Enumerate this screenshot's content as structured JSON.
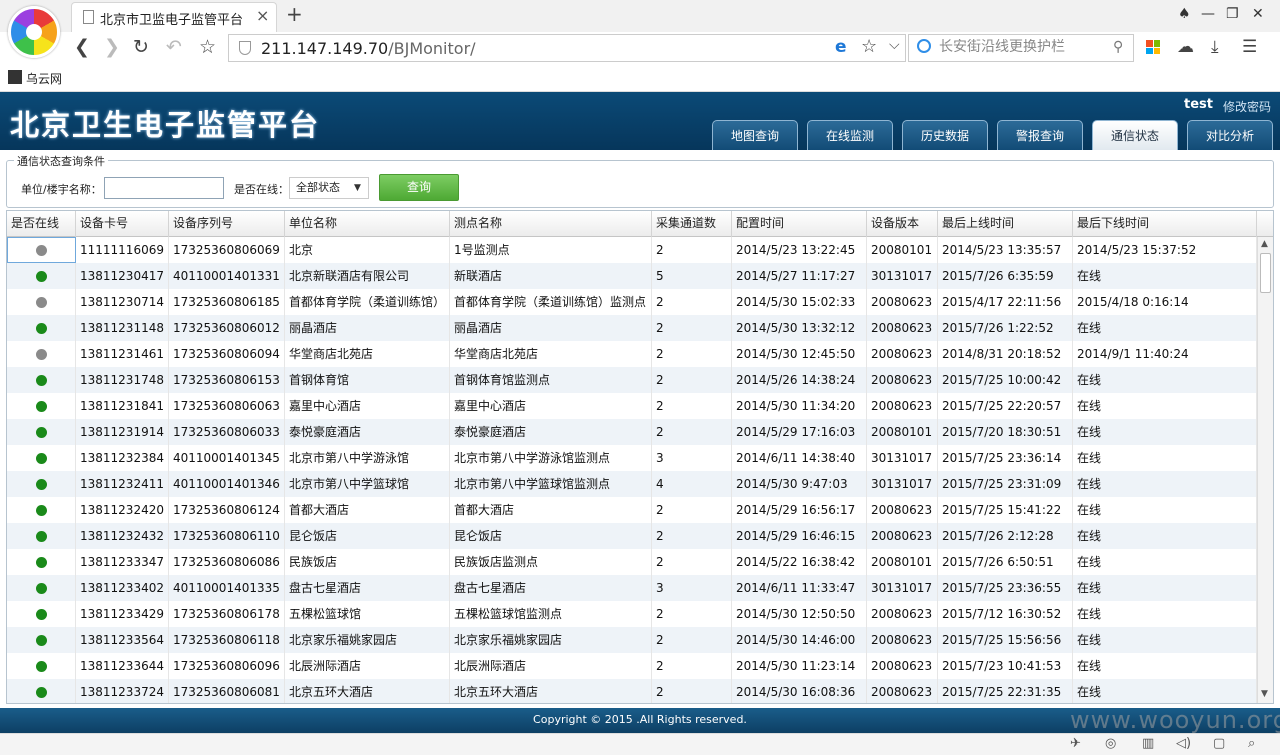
{
  "browser": {
    "tab_title": "北京市卫监电子监管平台",
    "address_host": "211.147.149.70",
    "address_path": "/BJMonitor/",
    "search_placeholder": "长安街沿线更换护栏",
    "bookmark_label": "乌云网"
  },
  "header": {
    "site_title": "北京卫生电子监管平台",
    "user_name": "test",
    "change_password": "修改密码",
    "tabs": [
      {
        "label": "地图查询",
        "active": false
      },
      {
        "label": "在线监测",
        "active": false
      },
      {
        "label": "历史数据",
        "active": false
      },
      {
        "label": "警报查询",
        "active": false
      },
      {
        "label": "通信状态",
        "active": true
      },
      {
        "label": "对比分析",
        "active": false
      }
    ]
  },
  "filter": {
    "legend": "通信状态查询条件",
    "unit_label": "单位/楼宇名称：",
    "unit_value": "",
    "online_label": "是否在线：",
    "status_selected": "全部状态",
    "query_button": "查询"
  },
  "table": {
    "columns": [
      "是否在线",
      "设备卡号",
      "设备序列号",
      "单位名称",
      "测点名称",
      "采集通道数",
      "配置时间",
      "设备版本",
      "最后上线时间",
      "最后下线时间"
    ],
    "status_colors": {
      "online": "#1a8a1a",
      "offline": "#8a8a8a"
    },
    "rows": [
      {
        "online": false,
        "card": "11111116069",
        "serial": "17325360806069",
        "unit": "北京",
        "point": "1号监测点",
        "channels": "2",
        "config_time": "2014/5/23 13:22:45",
        "version": "20080101",
        "last_online": "2014/5/23 13:35:57",
        "last_offline": "2014/5/23 15:37:52"
      },
      {
        "online": true,
        "card": "13811230417",
        "serial": "40110001401331",
        "unit": "北京新联酒店有限公司",
        "point": "新联酒店",
        "channels": "5",
        "config_time": "2014/5/27 11:17:27",
        "version": "30131017",
        "last_online": "2015/7/26 6:35:59",
        "last_offline": "在线"
      },
      {
        "online": false,
        "card": "13811230714",
        "serial": "17325360806185",
        "unit": "首都体育学院（柔道训练馆）",
        "point": "首都体育学院（柔道训练馆）监测点",
        "channels": "2",
        "config_time": "2014/5/30 15:02:33",
        "version": "20080623",
        "last_online": "2015/4/17 22:11:56",
        "last_offline": "2015/4/18 0:16:14"
      },
      {
        "online": true,
        "card": "13811231148",
        "serial": "17325360806012",
        "unit": "丽晶酒店",
        "point": "丽晶酒店",
        "channels": "2",
        "config_time": "2014/5/30 13:32:12",
        "version": "20080623",
        "last_online": "2015/7/26 1:22:52",
        "last_offline": "在线"
      },
      {
        "online": false,
        "card": "13811231461",
        "serial": "17325360806094",
        "unit": "华堂商店北苑店",
        "point": "华堂商店北苑店",
        "channels": "2",
        "config_time": "2014/5/30 12:45:50",
        "version": "20080623",
        "last_online": "2014/8/31 20:18:52",
        "last_offline": "2014/9/1 11:40:24"
      },
      {
        "online": true,
        "card": "13811231748",
        "serial": "17325360806153",
        "unit": "首钢体育馆",
        "point": "首钢体育馆监测点",
        "channels": "2",
        "config_time": "2014/5/26 14:38:24",
        "version": "20080623",
        "last_online": "2015/7/25 10:00:42",
        "last_offline": "在线"
      },
      {
        "online": true,
        "card": "13811231841",
        "serial": "17325360806063",
        "unit": "嘉里中心酒店",
        "point": "嘉里中心酒店",
        "channels": "2",
        "config_time": "2014/5/30 11:34:20",
        "version": "20080623",
        "last_online": "2015/7/25 22:20:57",
        "last_offline": "在线"
      },
      {
        "online": true,
        "card": "13811231914",
        "serial": "17325360806033",
        "unit": "泰悦豪庭酒店",
        "point": "泰悦豪庭酒店",
        "channels": "2",
        "config_time": "2014/5/29 17:16:03",
        "version": "20080101",
        "last_online": "2015/7/20 18:30:51",
        "last_offline": "在线"
      },
      {
        "online": true,
        "card": "13811232384",
        "serial": "40110001401345",
        "unit": "北京市第八中学游泳馆",
        "point": "北京市第八中学游泳馆监测点",
        "channels": "3",
        "config_time": "2014/6/11 14:38:40",
        "version": "30131017",
        "last_online": "2015/7/25 23:36:14",
        "last_offline": "在线"
      },
      {
        "online": true,
        "card": "13811232411",
        "serial": "40110001401346",
        "unit": "北京市第八中学篮球馆",
        "point": "北京市第八中学篮球馆监测点",
        "channels": "4",
        "config_time": "2014/5/30 9:47:03",
        "version": "30131017",
        "last_online": "2015/7/25 23:31:09",
        "last_offline": "在线"
      },
      {
        "online": true,
        "card": "13811232420",
        "serial": "17325360806124",
        "unit": "首都大酒店",
        "point": "首都大酒店",
        "channels": "2",
        "config_time": "2014/5/29 16:56:17",
        "version": "20080623",
        "last_online": "2015/7/25 15:41:22",
        "last_offline": "在线"
      },
      {
        "online": true,
        "card": "13811232432",
        "serial": "17325360806110",
        "unit": "昆仑饭店",
        "point": "昆仑饭店",
        "channels": "2",
        "config_time": "2014/5/29 16:46:15",
        "version": "20080623",
        "last_online": "2015/7/26 2:12:28",
        "last_offline": "在线"
      },
      {
        "online": true,
        "card": "13811233347",
        "serial": "17325360806086",
        "unit": "民族饭店",
        "point": "民族饭店监测点",
        "channels": "2",
        "config_time": "2014/5/22 16:38:42",
        "version": "20080101",
        "last_online": "2015/7/26 6:50:51",
        "last_offline": "在线"
      },
      {
        "online": true,
        "card": "13811233402",
        "serial": "40110001401335",
        "unit": "盘古七星酒店",
        "point": "盘古七星酒店",
        "channels": "3",
        "config_time": "2014/6/11 11:33:47",
        "version": "30131017",
        "last_online": "2015/7/25 23:36:55",
        "last_offline": "在线"
      },
      {
        "online": true,
        "card": "13811233429",
        "serial": "17325360806178",
        "unit": "五棵松篮球馆",
        "point": "五棵松篮球馆监测点",
        "channels": "2",
        "config_time": "2014/5/30 12:50:50",
        "version": "20080623",
        "last_online": "2015/7/12 16:30:52",
        "last_offline": "在线"
      },
      {
        "online": true,
        "card": "13811233564",
        "serial": "17325360806118",
        "unit": "北京家乐福姚家园店",
        "point": "北京家乐福姚家园店",
        "channels": "2",
        "config_time": "2014/5/30 14:46:00",
        "version": "20080623",
        "last_online": "2015/7/25 15:56:56",
        "last_offline": "在线"
      },
      {
        "online": true,
        "card": "13811233644",
        "serial": "17325360806096",
        "unit": "北辰洲际酒店",
        "point": "北辰洲际酒店",
        "channels": "2",
        "config_time": "2014/5/30 11:23:14",
        "version": "20080623",
        "last_online": "2015/7/23 10:41:53",
        "last_offline": "在线"
      },
      {
        "online": true,
        "card": "13811233724",
        "serial": "17325360806081",
        "unit": "北京五环大酒店",
        "point": "北京五环大酒店",
        "channels": "2",
        "config_time": "2014/5/30 16:08:36",
        "version": "20080623",
        "last_online": "2015/7/25 22:31:35",
        "last_offline": "在线"
      }
    ]
  },
  "footer": {
    "copyright": "Copyright © 2015 .All Rights reserved."
  },
  "watermark": "www.wooyun.org"
}
